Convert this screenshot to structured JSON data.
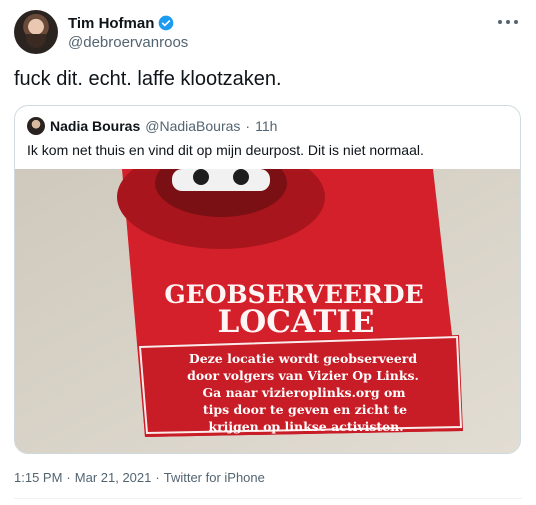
{
  "author": {
    "name": "Tim Hofman",
    "handle": "@debroervanroos"
  },
  "tweet": {
    "text": "fuck dit. echt. laffe klootzaken."
  },
  "quote": {
    "name": "Nadia Bouras",
    "handle": "@NadiaBouras",
    "separator": "·",
    "time": "11h",
    "text": "Ik kom net thuis en vind dit op mijn deurpost. Dit is niet normaal."
  },
  "photo": {
    "sticker_title_1": "GEOBSERVEERDE",
    "sticker_title_2": "LOCATIE",
    "sticker_body_lines": [
      "Deze locatie wordt geobserveerd",
      "door volgers van Vizier Op Links.",
      "Ga naar vizieroplinks.org om",
      "tips door te geven en zicht te",
      "krijgen op linkse activisten."
    ]
  },
  "meta": {
    "time": "1:15 PM",
    "separator": "·",
    "date": "Mar 21, 2021",
    "separator2": "·",
    "source": "Twitter for iPhone"
  },
  "colors": {
    "sticker_red": "#d4202a",
    "verified_blue": "#1d9bf0"
  },
  "icons": {
    "more": "more-icon",
    "verified": "verified-badge-icon"
  }
}
